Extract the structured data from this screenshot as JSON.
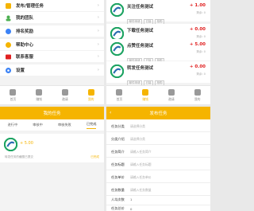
{
  "menu": {
    "items": [
      {
        "label": "发布/管理任务",
        "color": "#f5b400"
      },
      {
        "label": "我的团队",
        "color": "#4caf50"
      },
      {
        "label": "排名奖励",
        "color": "#3b82f6"
      },
      {
        "label": "帮助中心",
        "color": "#f5b400"
      },
      {
        "label": "联系客服",
        "color": "#e02020"
      },
      {
        "label": "设置",
        "color": "#3b82f6"
      }
    ],
    "arrow": "›"
  },
  "nav": {
    "items": [
      {
        "label": "首页"
      },
      {
        "label": "赚钱"
      },
      {
        "label": "邀请"
      },
      {
        "label": "我的"
      }
    ]
  },
  "tasks": [
    {
      "name": "关注任务测试",
      "price": "+ 1.00",
      "tag1": "邮件申请",
      "tag2": "已接",
      "tag3": "抢购",
      "remain": "剩余: 0"
    },
    {
      "name": "下载任务测试",
      "price": "+ 0.00",
      "tag1": "邮件申请",
      "tag2": "已接",
      "tag3": "抢购",
      "remain": "剩余: 0"
    },
    {
      "name": "点赞任务测试",
      "price": "+ 5.00",
      "tag1": "邮件申请",
      "tag2": "已接",
      "tag3": "抢购",
      "remain": "剩余: 0"
    },
    {
      "name": "转发任务测试",
      "price": "+ 0.00",
      "tag1": "邮件申请",
      "tag2": "已接",
      "tag3": "抢购",
      "remain": "剩余: 0"
    }
  ],
  "my_task": {
    "title": "我的任务",
    "tabs": [
      "进行中",
      "审核中",
      "审核失败",
      "已完成"
    ],
    "price": "+ 5.00",
    "desc": "转发任务的截图已提交",
    "status": "已完成"
  },
  "publish": {
    "title": "发布任务",
    "back": "‹",
    "rows": [
      {
        "label": "任务分类",
        "value": "请选择分类",
        "dark": false
      },
      {
        "label": "分类介绍",
        "value": "请选择分类",
        "dark": false
      },
      {
        "label": "任务简介",
        "value": "请输入任务简介",
        "dark": false
      },
      {
        "label": "任务标题",
        "value": "请输入任务标题",
        "dark": false
      },
      {
        "label": "任务单价",
        "value": "请输入任务单价",
        "dark": false
      },
      {
        "label": "任务数量",
        "value": "请输入任务数量",
        "dark": false
      },
      {
        "label": "人均次数",
        "value": "1",
        "dark": true
      },
      {
        "label": "任务总价",
        "value": "0",
        "dark": true
      }
    ]
  },
  "colors": {
    "accent": "#f5b400",
    "price": "#e02020",
    "logo_green": "#1aa260",
    "logo_blue": "#2b6cb0"
  }
}
